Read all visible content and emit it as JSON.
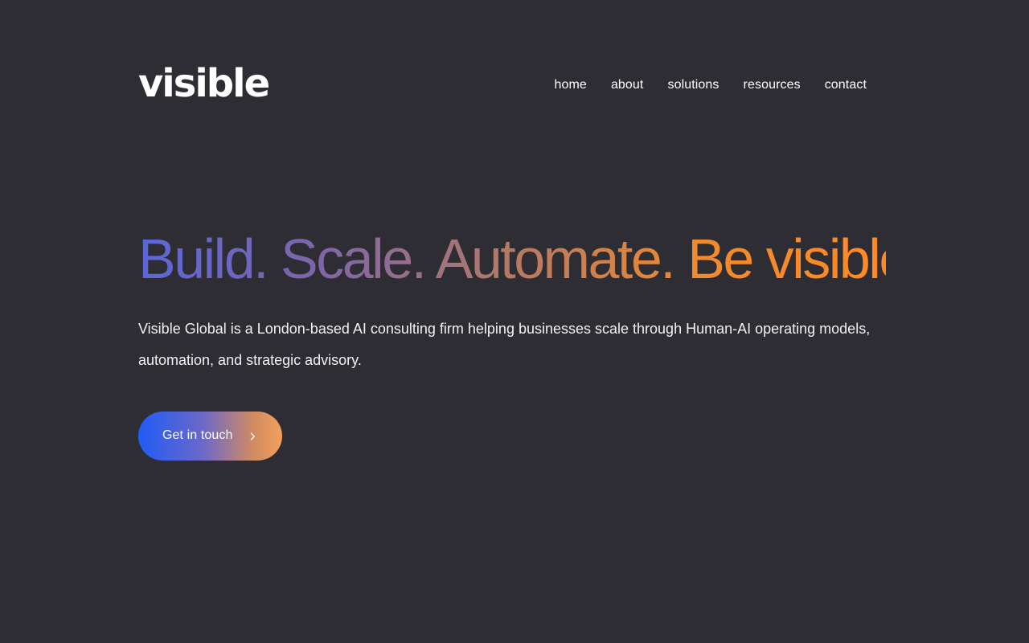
{
  "header": {
    "logo_text": "visible",
    "nav": {
      "items": [
        {
          "label": "home"
        },
        {
          "label": "about"
        },
        {
          "label": "solutions"
        },
        {
          "label": "resources"
        },
        {
          "label": "contact"
        }
      ]
    }
  },
  "hero": {
    "headline": "Build. Scale. Automate. Be visible.",
    "description": "Visible Global is a London-based AI consulting firm helping businesses scale through Human-AI operating models, automation, and strategic advisory.",
    "cta": {
      "label": "Get in touch",
      "icon": "chevron-right-icon"
    }
  },
  "colors": {
    "background": "#2e2d33",
    "text": "#ffffff",
    "headline_gradient": [
      "#5a67d8",
      "#7f66a7",
      "#b47a65",
      "#f08a2f",
      "#ff8a23"
    ],
    "cta_gradient": [
      "#1f5cf6",
      "#6c68c8",
      "#d18b61",
      "#f2a05b"
    ]
  }
}
